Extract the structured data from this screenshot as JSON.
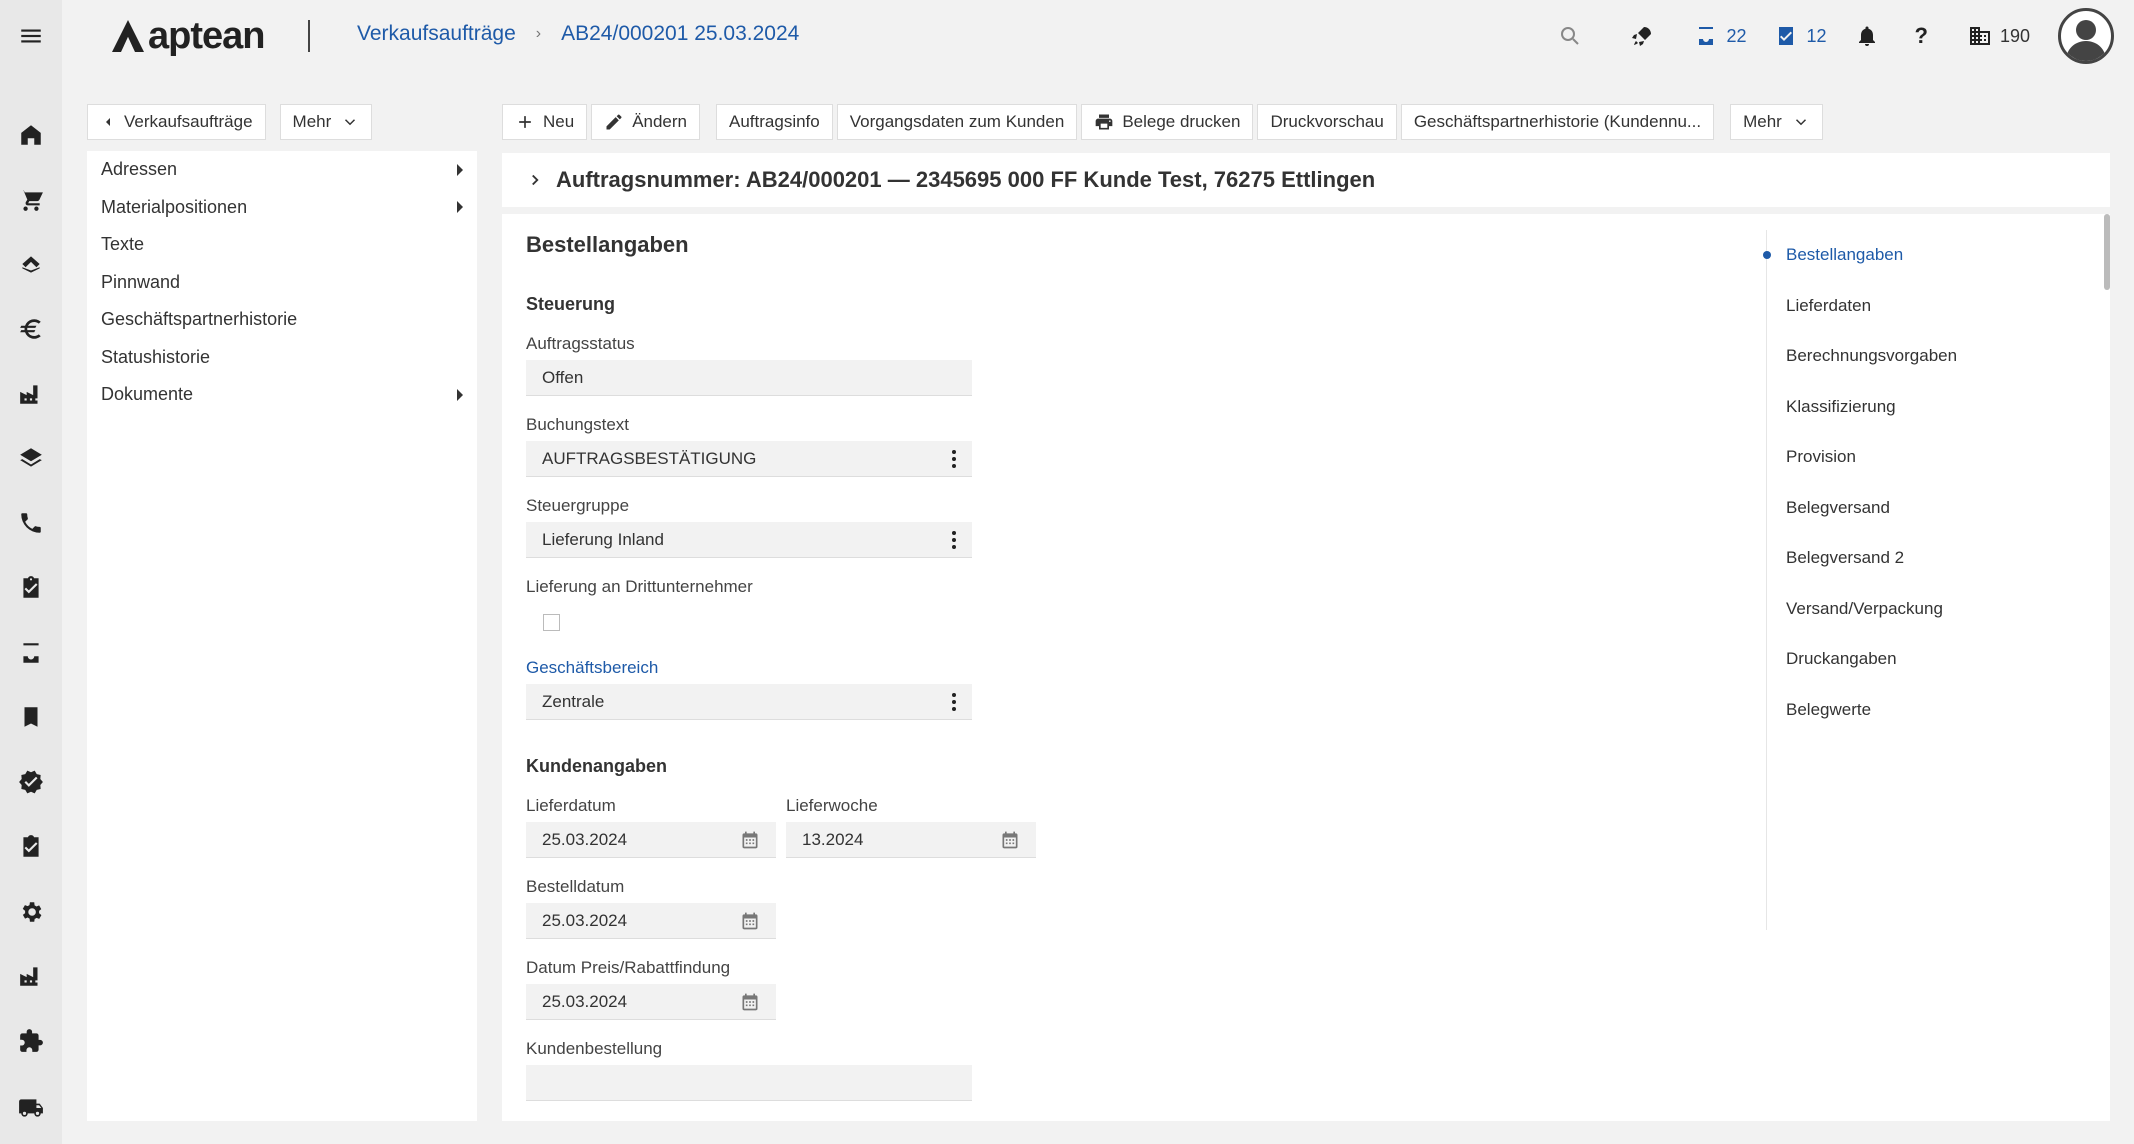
{
  "app": {
    "logo_text": "aptean"
  },
  "breadcrumb": {
    "root": "Verkaufsaufträge",
    "current": "AB24/000201 25.03.2024"
  },
  "top_actions": {
    "inbox_count": "22",
    "tasks_count": "12",
    "company_count": "190",
    "help": "?"
  },
  "left_toolbar": {
    "back_label": "Verkaufsaufträge",
    "more_label": "Mehr"
  },
  "left_nav": [
    {
      "label": "Adressen",
      "has_children": true
    },
    {
      "label": "Materialpositionen",
      "has_children": true
    },
    {
      "label": "Texte",
      "has_children": false
    },
    {
      "label": "Pinnwand",
      "has_children": false
    },
    {
      "label": "Geschäftspartnerhistorie",
      "has_children": false
    },
    {
      "label": "Statushistorie",
      "has_children": false
    },
    {
      "label": "Dokumente",
      "has_children": true
    }
  ],
  "toolbar": {
    "new": "Neu",
    "edit": "Ändern",
    "order_info": "Auftragsinfo",
    "customer_data": "Vorgangsdaten zum Kunden",
    "print_docs": "Belege drucken",
    "print_preview": "Druckvorschau",
    "partner_history": "Geschäftspartnerhistorie (Kundennu...",
    "more": "Mehr"
  },
  "order_header": "Auftragsnummer: AB24/000201 — 2345695 000 FF Kunde Test, 76275 Ettlingen",
  "form": {
    "section_title": "Bestellangaben",
    "steuerung_title": "Steuerung",
    "auftragsstatus_label": "Auftragsstatus",
    "auftragsstatus_value": "Offen",
    "buchungstext_label": "Buchungstext",
    "buchungstext_value": "AUFTRAGSBESTÄTIGUNG",
    "steuergruppe_label": "Steuergruppe",
    "steuergruppe_value": "Lieferung Inland",
    "dritt_label": "Lieferung an Drittunternehmer",
    "geschaeftsbereich_label": "Geschäftsbereich",
    "geschaeftsbereich_value": "Zentrale",
    "kunden_title": "Kundenangaben",
    "lieferdatum_label": "Lieferdatum",
    "lieferdatum_value": "25.03.2024",
    "lieferwoche_label": "Lieferwoche",
    "lieferwoche_value": "13.2024",
    "bestelldatum_label": "Bestelldatum",
    "bestelldatum_value": "25.03.2024",
    "preisdatum_label": "Datum Preis/Rabattfindung",
    "preisdatum_value": "25.03.2024",
    "kundenbestellung_label": "Kundenbestellung",
    "kundenbestellung_value": ""
  },
  "anchors": [
    {
      "label": "Bestellangaben",
      "active": true
    },
    {
      "label": "Lieferdaten"
    },
    {
      "label": "Berechnungsvorgaben"
    },
    {
      "label": "Klassifizierung"
    },
    {
      "label": "Provision"
    },
    {
      "label": "Belegversand"
    },
    {
      "label": "Belegversand 2"
    },
    {
      "label": "Versand/Verpackung"
    },
    {
      "label": "Druckangaben"
    },
    {
      "label": "Belegwerte"
    }
  ],
  "rail_icons": [
    "menu-icon",
    "home-icon",
    "cart-icon",
    "handshake-icon",
    "euro-icon",
    "factory-icon",
    "layers-icon",
    "phone-icon",
    "clipboard-check-icon",
    "inbox-icon",
    "bookmark-icon",
    "verified-icon",
    "task-icon",
    "settings-icon",
    "factory-icon",
    "puzzle-icon",
    "truck-icon"
  ],
  "colors": {
    "accent": "#1e5aa8",
    "rail_bg": "#e8e8e8",
    "page_bg": "#f2f2f2"
  }
}
